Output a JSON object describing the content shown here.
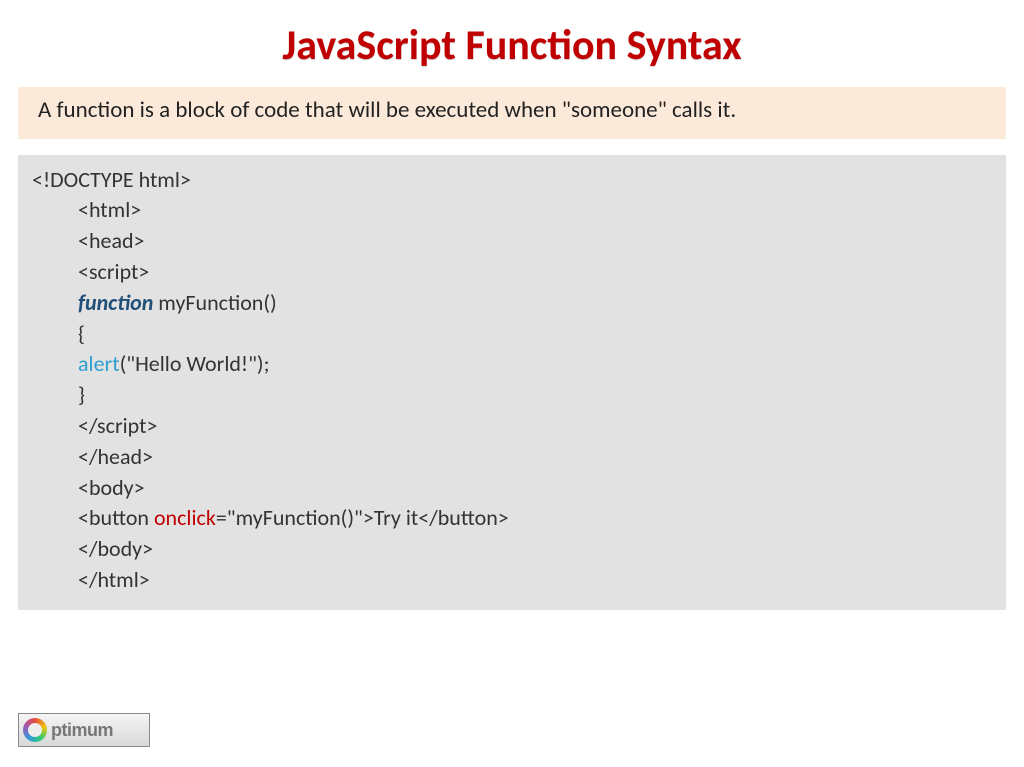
{
  "title": "JavaScript Function Syntax",
  "intro": "A function is a block of code that will be executed when \"someone\" calls it.",
  "code": {
    "l1": "<!DOCTYPE html>",
    "l2": "<html>",
    "l3": "<head>",
    "l4": "<script>",
    "l5_kw": "function",
    "l5_rest": " myFunction()",
    "l6": "{",
    "l7_kw": "alert",
    "l7_rest": "(\"Hello World!\");",
    "l8": "}",
    "l9": "</script>",
    "l10": "</head>",
    "l11": "<body>",
    "l12_a": "<button ",
    "l12_kw": "onclick",
    "l12_b": "=\"myFunction()\">Try it</button>",
    "l13": "</body>",
    "l14": "</html>"
  },
  "logo": "ptimum"
}
